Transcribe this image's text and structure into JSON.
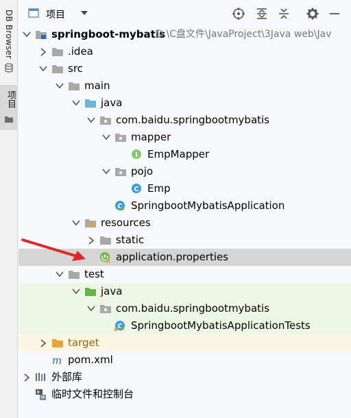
{
  "sidebar": {
    "db_browser_label": "DB Browser",
    "project_label": "项目"
  },
  "header": {
    "title": "项目"
  },
  "colors": {
    "folder_gray": "#a9a9a9",
    "folder_blue": "#6fb3d9",
    "folder_green": "#62b543",
    "folder_orange": "#e5a43c",
    "interface_green": "#8ac872",
    "class_blue": "#3c9ed8",
    "spring_green": "#6db33f",
    "red_arrow": "#e0282a"
  },
  "tree": [
    {
      "label": "springboot-mybatis",
      "path": "D:\\C盘文件\\JavaProject\\3Java web\\Jav",
      "icon": "module-folder-icon",
      "expanded": true
    },
    {
      "label": ".idea",
      "icon": "folder-icon",
      "expanded": false
    },
    {
      "label": "src",
      "icon": "folder-icon",
      "expanded": true
    },
    {
      "label": "main",
      "icon": "folder-icon",
      "expanded": true
    },
    {
      "label": "java",
      "icon": "source-folder-icon",
      "expanded": true
    },
    {
      "label": "com.baidu.springbootmybatis",
      "icon": "package-icon",
      "expanded": true
    },
    {
      "label": "mapper",
      "icon": "package-icon",
      "expanded": true
    },
    {
      "label": "EmpMapper",
      "icon": "interface-icon"
    },
    {
      "label": "pojo",
      "icon": "package-icon",
      "expanded": true
    },
    {
      "label": "Emp",
      "icon": "class-icon"
    },
    {
      "label": "SpringbootMybatisApplication",
      "icon": "spring-boot-class-icon"
    },
    {
      "label": "resources",
      "icon": "resources-folder-icon",
      "expanded": true
    },
    {
      "label": "static",
      "icon": "folder-icon",
      "expanded": false
    },
    {
      "label": "application.properties",
      "icon": "spring-properties-icon"
    },
    {
      "label": "test",
      "icon": "folder-icon",
      "expanded": true
    },
    {
      "label": "java",
      "icon": "test-source-folder-icon",
      "expanded": true
    },
    {
      "label": "com.baidu.springbootmybatis",
      "icon": "package-icon",
      "expanded": true
    },
    {
      "label": "SpringbootMybatisApplicationTests",
      "icon": "spring-boot-test-class-icon"
    },
    {
      "label": "target",
      "icon": "excluded-folder-icon",
      "expanded": false
    },
    {
      "label": "pom.xml",
      "icon": "maven-icon"
    },
    {
      "label": "外部库",
      "icon": "external-libraries-icon",
      "expanded": false
    },
    {
      "label": "临时文件和控制台",
      "icon": "scratches-icon"
    }
  ]
}
